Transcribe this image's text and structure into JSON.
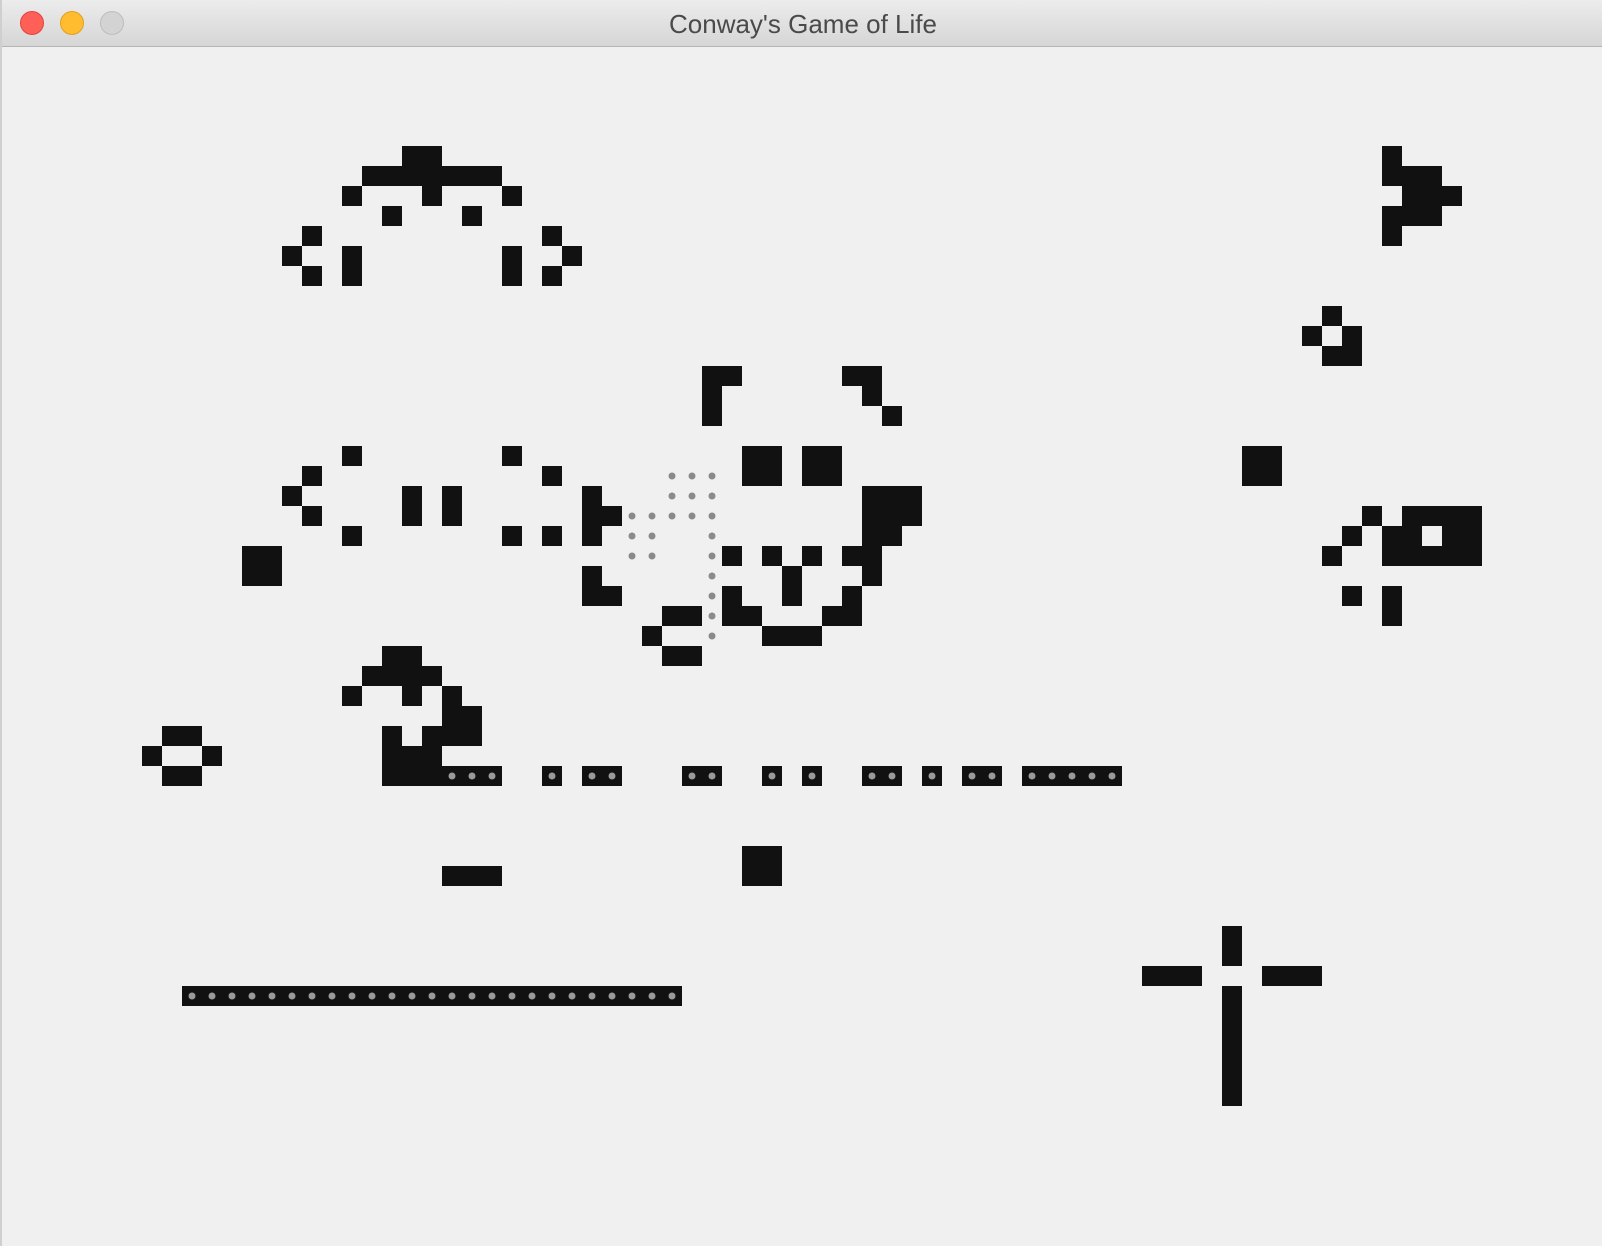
{
  "window": {
    "title": "Conway's Game of Life"
  },
  "colors": {
    "background": "#f0f0f0",
    "live_cell": "#111111",
    "ghost_dot": "#8a8a8a",
    "inner_dot": "#9a9a9a"
  },
  "grid": {
    "cell_units": "columns and rows of the life board",
    "cols": 80,
    "rows": 60
  },
  "cells": [
    [
      20,
      5
    ],
    [
      21,
      5
    ],
    [
      18,
      6
    ],
    [
      19,
      6
    ],
    [
      20,
      6
    ],
    [
      21,
      6
    ],
    [
      22,
      6
    ],
    [
      23,
      6
    ],
    [
      24,
      6
    ],
    [
      17,
      7
    ],
    [
      21,
      7
    ],
    [
      25,
      7
    ],
    [
      19,
      8
    ],
    [
      23,
      8
    ],
    [
      15,
      9
    ],
    [
      27,
      9
    ],
    [
      14,
      10
    ],
    [
      17,
      10
    ],
    [
      25,
      10
    ],
    [
      28,
      10
    ],
    [
      15,
      11
    ],
    [
      17,
      11
    ],
    [
      25,
      11
    ],
    [
      27,
      11
    ],
    [
      69,
      5
    ],
    [
      69,
      6
    ],
    [
      70,
      6
    ],
    [
      71,
      6
    ],
    [
      70,
      7
    ],
    [
      71,
      7
    ],
    [
      72,
      7
    ],
    [
      69,
      8
    ],
    [
      70,
      8
    ],
    [
      71,
      8
    ],
    [
      69,
      9
    ],
    [
      66,
      13
    ],
    [
      65,
      14
    ],
    [
      67,
      14
    ],
    [
      66,
      15
    ],
    [
      67,
      15
    ],
    [
      35,
      16
    ],
    [
      36,
      16
    ],
    [
      42,
      16
    ],
    [
      43,
      16
    ],
    [
      35,
      17
    ],
    [
      43,
      17
    ],
    [
      35,
      18
    ],
    [
      44,
      18
    ],
    [
      37,
      20
    ],
    [
      38,
      20
    ],
    [
      40,
      20
    ],
    [
      41,
      20
    ],
    [
      37,
      21
    ],
    [
      38,
      21
    ],
    [
      40,
      21
    ],
    [
      41,
      21
    ],
    [
      62,
      20
    ],
    [
      63,
      20
    ],
    [
      62,
      21
    ],
    [
      63,
      21
    ],
    [
      17,
      20
    ],
    [
      25,
      20
    ],
    [
      15,
      21
    ],
    [
      27,
      21
    ],
    [
      14,
      22
    ],
    [
      20,
      22
    ],
    [
      22,
      22
    ],
    [
      15,
      23
    ],
    [
      20,
      23
    ],
    [
      22,
      23
    ],
    [
      20,
      22
    ],
    [
      17,
      24
    ],
    [
      25,
      24
    ],
    [
      27,
      24
    ],
    [
      20,
      23
    ],
    [
      22,
      23
    ],
    [
      29,
      22
    ],
    [
      29,
      23
    ],
    [
      30,
      23
    ],
    [
      29,
      24
    ],
    [
      43,
      22
    ],
    [
      44,
      22
    ],
    [
      45,
      22
    ],
    [
      43,
      23
    ],
    [
      44,
      23
    ],
    [
      45,
      23
    ],
    [
      43,
      24
    ],
    [
      44,
      24
    ],
    [
      42,
      25
    ],
    [
      43,
      25
    ],
    [
      43,
      26
    ],
    [
      68,
      23
    ],
    [
      70,
      23
    ],
    [
      71,
      23
    ],
    [
      72,
      23
    ],
    [
      73,
      23
    ],
    [
      67,
      24
    ],
    [
      69,
      24
    ],
    [
      70,
      24
    ],
    [
      72,
      24
    ],
    [
      73,
      24
    ],
    [
      66,
      25
    ],
    [
      69,
      25
    ],
    [
      70,
      25
    ],
    [
      71,
      25
    ],
    [
      72,
      25
    ],
    [
      73,
      25
    ],
    [
      67,
      27
    ],
    [
      69,
      27
    ],
    [
      69,
      28
    ],
    [
      12,
      25
    ],
    [
      13,
      25
    ],
    [
      12,
      26
    ],
    [
      13,
      26
    ],
    [
      36,
      25
    ],
    [
      38,
      25
    ],
    [
      40,
      25
    ],
    [
      39,
      26
    ],
    [
      39,
      27
    ],
    [
      29,
      26
    ],
    [
      29,
      27
    ],
    [
      30,
      27
    ],
    [
      36,
      27
    ],
    [
      36,
      28
    ],
    [
      37,
      28
    ],
    [
      42,
      27
    ],
    [
      42,
      28
    ],
    [
      41,
      28
    ],
    [
      33,
      28
    ],
    [
      34,
      28
    ],
    [
      32,
      29
    ],
    [
      33,
      30
    ],
    [
      34,
      30
    ],
    [
      38,
      29
    ],
    [
      39,
      29
    ],
    [
      40,
      29
    ],
    [
      19,
      30
    ],
    [
      20,
      30
    ],
    [
      18,
      31
    ],
    [
      19,
      31
    ],
    [
      20,
      31
    ],
    [
      21,
      31
    ],
    [
      17,
      32
    ],
    [
      20,
      32
    ],
    [
      22,
      32
    ],
    [
      22,
      33
    ],
    [
      23,
      33
    ],
    [
      19,
      34
    ],
    [
      21,
      34
    ],
    [
      22,
      34
    ],
    [
      23,
      34
    ],
    [
      19,
      35
    ],
    [
      20,
      35
    ],
    [
      21,
      35
    ],
    [
      8,
      34
    ],
    [
      9,
      34
    ],
    [
      7,
      35
    ],
    [
      10,
      35
    ],
    [
      8,
      36
    ],
    [
      9,
      36
    ],
    [
      37,
      40
    ],
    [
      38,
      40
    ],
    [
      37,
      41
    ],
    [
      38,
      41
    ],
    [
      22,
      41
    ],
    [
      23,
      41
    ],
    [
      24,
      41
    ],
    [
      61,
      44
    ],
    [
      61,
      45
    ],
    [
      57,
      46
    ],
    [
      58,
      46
    ],
    [
      59,
      46
    ],
    [
      63,
      46
    ],
    [
      64,
      46
    ],
    [
      65,
      46
    ],
    [
      61,
      47
    ],
    [
      61,
      48
    ],
    [
      61,
      49
    ],
    [
      61,
      50
    ],
    [
      61,
      51
    ],
    [
      61,
      52
    ]
  ],
  "dotted_rows": [
    {
      "row": 36,
      "segments": [
        [
          22,
          25
        ],
        [
          27,
          28
        ],
        [
          29,
          31
        ],
        [
          34,
          36
        ],
        [
          38,
          39
        ],
        [
          40,
          41
        ],
        [
          43,
          45
        ],
        [
          46,
          47
        ],
        [
          48,
          50
        ],
        [
          51,
          56
        ]
      ],
      "solid_start": [
        19,
        22
      ]
    },
    {
      "row": 47,
      "segments": [
        [
          9,
          34
        ]
      ],
      "solid_start": null
    }
  ],
  "ghost_dots": [
    [
      33,
      21
    ],
    [
      34,
      21
    ],
    [
      35,
      21
    ],
    [
      33,
      22
    ],
    [
      34,
      22
    ],
    [
      35,
      22
    ],
    [
      31,
      23
    ],
    [
      32,
      23
    ],
    [
      33,
      23
    ],
    [
      34,
      23
    ],
    [
      35,
      23
    ],
    [
      31,
      24
    ],
    [
      32,
      24
    ],
    [
      35,
      24
    ],
    [
      31,
      25
    ],
    [
      32,
      25
    ],
    [
      35,
      25
    ],
    [
      35,
      26
    ],
    [
      35,
      27
    ],
    [
      35,
      28
    ],
    [
      35,
      29
    ]
  ]
}
